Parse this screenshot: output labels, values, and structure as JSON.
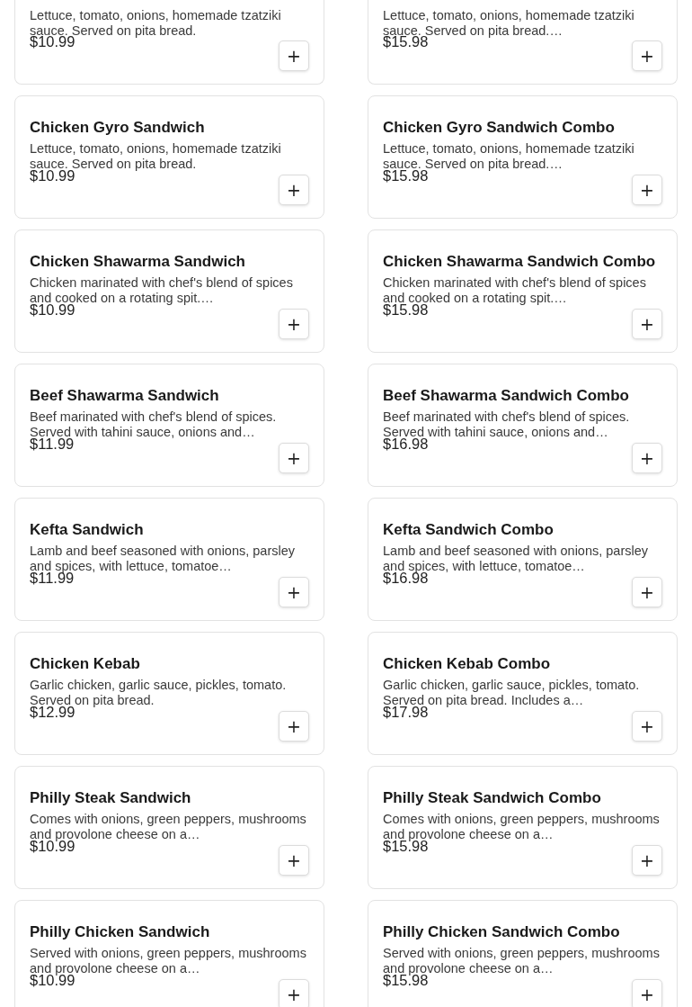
{
  "menu_items": [
    {
      "price": "$10.99",
      "description": "Lettuce, tomato, onions, homemade tzatziki sauce. Served on pita bread.",
      "add_label": "+"
    },
    {
      "price": "$15.98",
      "description": "Lettuce, tomato, onions, homemade tzatziki sauce. Served on pita bread.…",
      "add_label": "+"
    },
    {
      "title": "Chicken Gyro Sandwich",
      "price": "$10.99",
      "description": "Lettuce, tomato, onions, homemade tzatziki sauce. Served on pita bread.",
      "add_label": "+"
    },
    {
      "title": "Chicken Gyro Sandwich Combo",
      "price": "$15.98",
      "description": "Lettuce, tomato, onions, homemade tzatziki sauce. Served on pita bread.…",
      "add_label": "+"
    },
    {
      "title": "Chicken Shawarma Sandwich",
      "price": "$10.99",
      "description": "Chicken marinated with chef's blend of spices and cooked on a rotating spit.…",
      "add_label": "+"
    },
    {
      "title": "Chicken Shawarma Sandwich Combo",
      "price": "$15.98",
      "description": "Chicken marinated with chef's blend of spices and cooked on a rotating spit.…",
      "add_label": "+"
    },
    {
      "title": "Beef Shawarma Sandwich",
      "price": "$11.99",
      "description": "Beef marinated with chef's blend of spices. Served with tahini sauce, onions and…",
      "add_label": "+"
    },
    {
      "title": "Beef Shawarma Sandwich Combo",
      "price": "$16.98",
      "description": "Beef marinated with chef's blend of spices. Served with tahini sauce, onions and…",
      "add_label": "+"
    },
    {
      "title": "Kefta Sandwich",
      "price": "$11.99",
      "description": "Lamb and beef seasoned with onions, parsley and spices, with lettuce, tomatoe…",
      "add_label": "+"
    },
    {
      "title": "Kefta Sandwich Combo",
      "price": "$16.98",
      "description": "Lamb and beef seasoned with onions, parsley and spices, with lettuce, tomatoe…",
      "add_label": "+"
    },
    {
      "title": "Chicken Kebab",
      "price": "$12.99",
      "description": "Garlic chicken, garlic sauce, pickles, tomato. Served on pita bread.",
      "add_label": "+"
    },
    {
      "title": "Chicken Kebab Combo",
      "price": "$17.98",
      "description": "Garlic chicken, garlic sauce, pickles, tomato. Served on pita bread. Includes a…",
      "add_label": "+"
    },
    {
      "title": "Philly Steak Sandwich",
      "price": "$10.99",
      "description": "Comes with onions, green peppers, mushrooms and provolone cheese on a…",
      "add_label": "+"
    },
    {
      "title": "Philly Steak Sandwich Combo",
      "price": "$15.98",
      "description": "Comes with onions, green peppers, mushrooms and provolone cheese on a…",
      "add_label": "+"
    },
    {
      "title": "Philly Chicken Sandwich",
      "price": "$10.99",
      "description": "Served with onions, green peppers, mushrooms and provolone cheese on a…",
      "add_label": "+"
    },
    {
      "title": "Philly Chicken Sandwich Combo",
      "price": "$15.98",
      "description": "Served with onions, green peppers, mushrooms and provolone cheese on a…",
      "add_label": "+"
    }
  ]
}
